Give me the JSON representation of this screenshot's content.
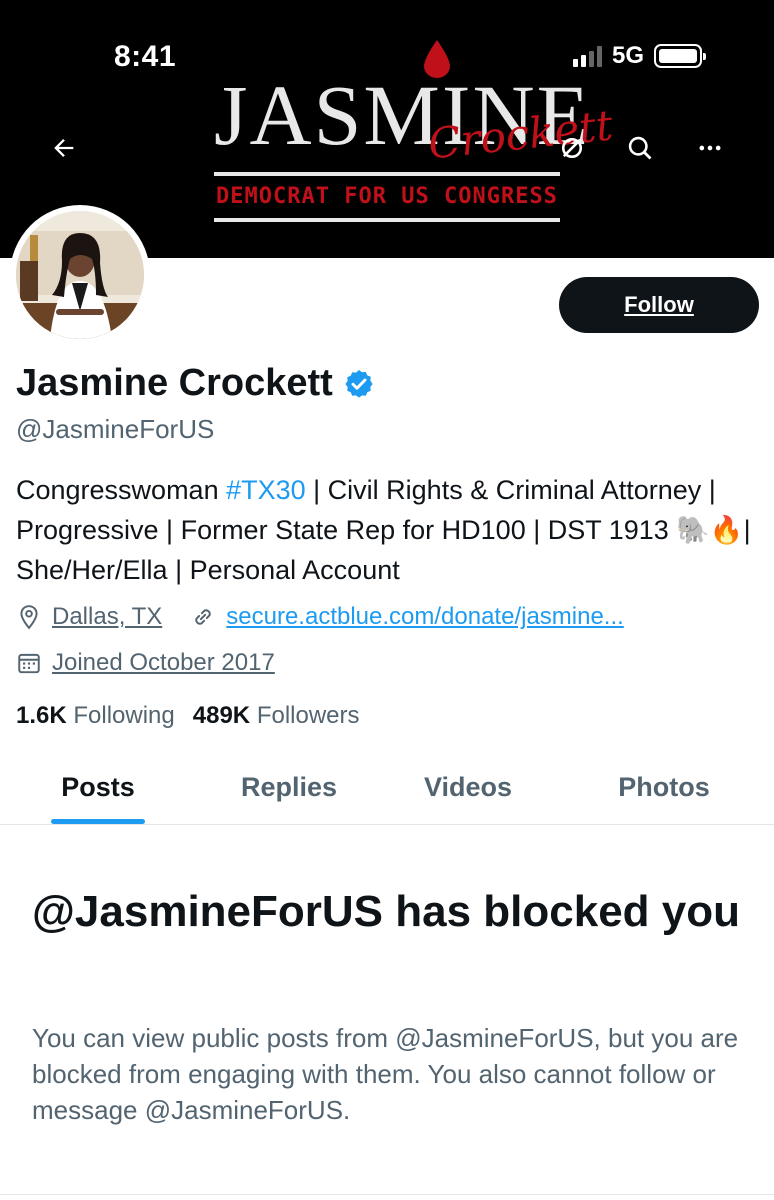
{
  "status_bar": {
    "time": "8:41",
    "network": "5G"
  },
  "banner": {
    "logo_title": "JASMINE",
    "logo_script": "Crockett",
    "logo_subtitle": "DEMOCRAT FOR US CONGRESS"
  },
  "profile": {
    "name": "Jasmine Crockett",
    "handle": "@JasmineForUS",
    "follow_label": "Follow",
    "bio": {
      "part1": "Congresswoman ",
      "hashtag": "#TX30",
      "part2": " | Civil Rights & Criminal Attorney | Progressive | Former State Rep for HD100 | DST 1913 ",
      "emoji": "🐘🔥",
      "part3": "| She/Her/Ella | Personal Account"
    },
    "location": "Dallas, TX",
    "website": "secure.actblue.com/donate/jasmine...",
    "joined": "Joined October 2017",
    "following_count": "1.6K",
    "following_label": "Following",
    "followers_count": "489K",
    "followers_label": "Followers"
  },
  "tabs": [
    {
      "label": "Posts"
    },
    {
      "label": "Replies"
    },
    {
      "label": "Videos"
    },
    {
      "label": "Photos"
    }
  ],
  "blocked": {
    "title": "@JasmineForUS has blocked you",
    "message": "You can view public posts from @JasmineForUS, but you are blocked from engaging with them. You also cannot follow or message @JasmineForUS."
  },
  "colors": {
    "accent": "#1d9bf0",
    "text": "#0f1419",
    "secondary": "#536471",
    "brand_red": "#c0101a"
  },
  "icons": [
    "back-arrow-icon",
    "grok-icon",
    "search-icon",
    "more-icon",
    "verified-badge-icon",
    "location-icon",
    "link-icon",
    "calendar-icon"
  ]
}
